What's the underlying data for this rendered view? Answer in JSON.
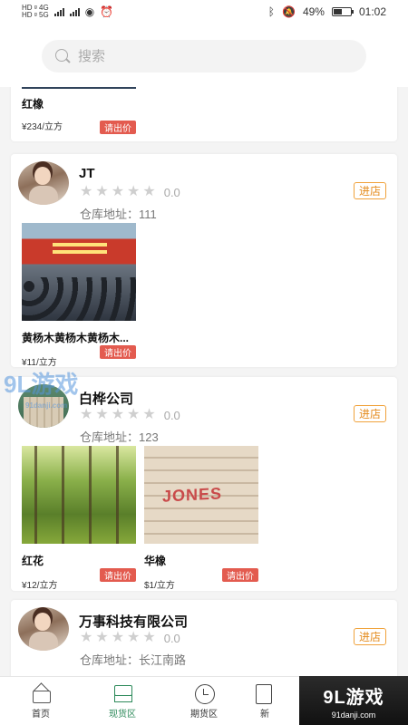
{
  "status_bar": {
    "net_top": "HD ᵍ 4G",
    "net_bottom": "HD ᵍ 5G",
    "battery": "49%",
    "battery_level": 0.49,
    "time": "01:02"
  },
  "search": {
    "placeholder": "搜索"
  },
  "cards": [
    {
      "products": [
        {
          "name": "红橡",
          "price": "¥234/立方",
          "quote": "请出价"
        }
      ]
    },
    {
      "shop": "JT",
      "rating": "0.0",
      "address": "仓库地址：111",
      "enter": "进店",
      "products": [
        {
          "name": "黄杨木黄杨木黄杨木...",
          "price": "¥11/立方",
          "quote": "请出价"
        }
      ]
    },
    {
      "shop": "白桦公司",
      "rating": "0.0",
      "address": "仓库地址：123",
      "enter": "进店",
      "products": [
        {
          "name": "红花",
          "price": "¥12/立方",
          "quote": "请出价"
        },
        {
          "name": "华橡",
          "price": "$1/立方",
          "quote": "请出价"
        }
      ]
    },
    {
      "shop": "万事科技有限公司",
      "rating": "0.0",
      "address": "仓库地址：长江南路",
      "enter": "进店"
    }
  ],
  "bottom_nav": [
    {
      "label": "首页"
    },
    {
      "label": "现货区"
    },
    {
      "label": "期货区"
    },
    {
      "label": "新"
    }
  ],
  "watermark": {
    "main": "9L游戏",
    "sub": "91danji.com"
  },
  "ad_badge": {
    "main": "9L游戏",
    "sub": "91danji.com"
  },
  "colors": {
    "accent_green": "#2d8a5a",
    "quote_red": "#e35b4f",
    "enter_orange": "#e48a1a"
  }
}
